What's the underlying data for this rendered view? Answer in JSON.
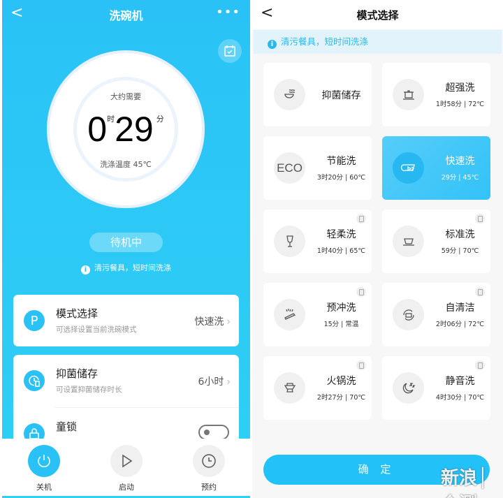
{
  "left": {
    "header": {
      "back": "<",
      "title": "洗碗机",
      "more": "•••"
    },
    "dial": {
      "label": "大约需要",
      "hours": "0",
      "hours_unit": "时",
      "minutes": "29",
      "minutes_unit": "分",
      "temp": "洗涤温度 45℃"
    },
    "status": "待机中",
    "tip": "清污餐具，短时间洗涤",
    "settings": [
      {
        "icon": "P",
        "title": "模式选择",
        "subtitle": "可选择设置当前洗碗模式",
        "value": "快速洗"
      },
      {
        "icon": "sterilize-storage-icon",
        "title": "抑菌储存",
        "subtitle": "可设置抑菌储存时长",
        "value": "6小时"
      },
      {
        "icon": "lock-icon",
        "title": "童锁",
        "toggle": false
      }
    ],
    "nav": [
      {
        "label": "关机",
        "active": true
      },
      {
        "label": "启动"
      },
      {
        "label": "预约"
      }
    ]
  },
  "right": {
    "header": {
      "back": "<",
      "title": "模式选择"
    },
    "banner": "清污餐具，短时间洗涤",
    "modes": [
      {
        "name": "抑菌储存",
        "detail": "",
        "icon": "bowl-steam-icon"
      },
      {
        "name": "超强洗",
        "detail": "1时58分 | 72℃",
        "icon": "pot-icon"
      },
      {
        "name": "节能洗",
        "detail": "3时20分 | 60℃",
        "icon": "eco-icon",
        "icon_text": "ECO"
      },
      {
        "name": "快速洗",
        "detail": "29分 | 45℃",
        "icon": "fast-bowl-icon",
        "selected": true
      },
      {
        "name": "轻柔洗",
        "detail": "1时40分 | 65℃",
        "icon": "wine-glass-icon",
        "badge": true
      },
      {
        "name": "标准洗",
        "detail": "59分 | 70℃",
        "icon": "bowl-icon",
        "badge": true
      },
      {
        "name": "预冲洗",
        "detail": "15分 | 常温",
        "icon": "rinse-icon",
        "badge": true
      },
      {
        "name": "自清洁",
        "detail": "2时06分 | 72℃",
        "icon": "self-clean-icon",
        "badge": true
      },
      {
        "name": "火锅洗",
        "detail": "2时27分 | 70℃",
        "icon": "hotpot-icon",
        "badge": true
      },
      {
        "name": "静音洗",
        "detail": "4时30分 | 70℃",
        "icon": "moon-zzz-icon",
        "badge": true
      }
    ],
    "confirm": "确 定",
    "watermark": "新浪 众测"
  },
  "colors": {
    "accent": "#2ac2f6",
    "selected": "#33c2f8",
    "banner_bg": "#e2f3fb"
  }
}
